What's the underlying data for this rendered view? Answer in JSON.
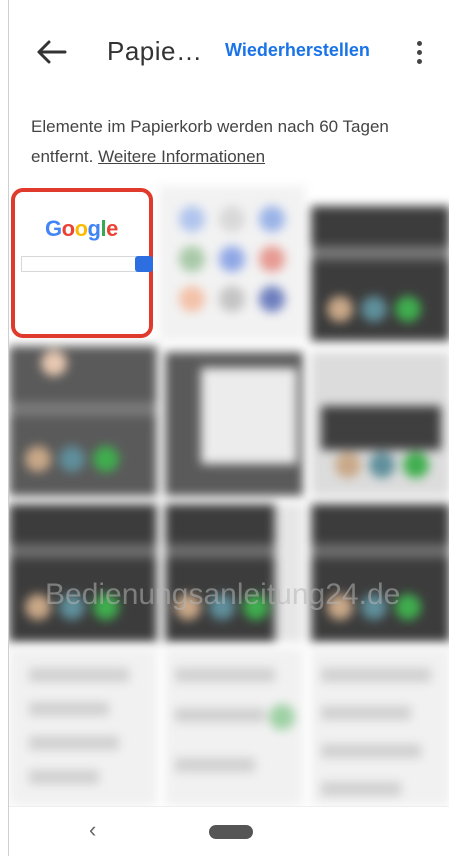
{
  "header": {
    "title": "Papie…",
    "restore_label": "Wiederherstellen"
  },
  "info": {
    "text": "Elemente im Papierkorb werden nach 60 Tagen entfernt.",
    "link": "Weitere Informationen"
  },
  "selected_item": {
    "logo_text": "Google"
  },
  "watermark": "Bedienungsanleitung24.de",
  "nav": {
    "back_icon": "‹"
  },
  "colors": {
    "accent": "#1a73e8",
    "selection": "#e03a2c"
  }
}
